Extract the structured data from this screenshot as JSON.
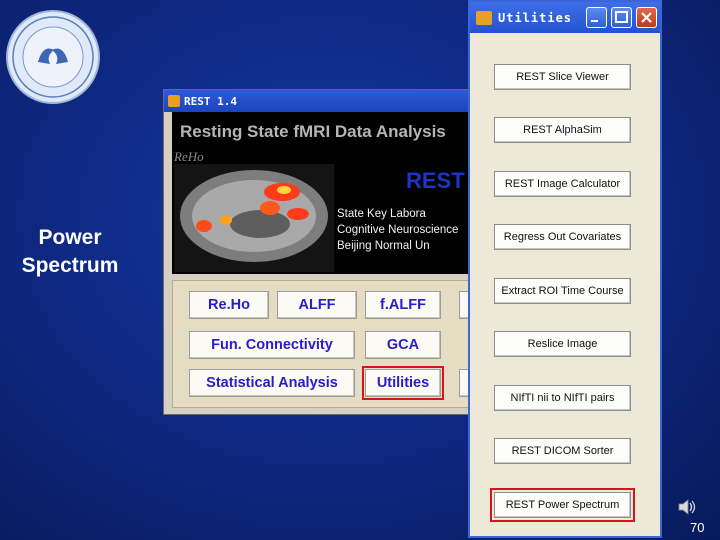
{
  "slide": {
    "label_line1": "Power",
    "label_line2": "Spectrum",
    "page_number": "70"
  },
  "rest_window": {
    "title": "REST 1.4",
    "header_title": "Resting State fMRI Data Analysis",
    "reho_watermark": "ReHo",
    "brand": "REST",
    "lab_lines": [
      "State Key Labora",
      "Cognitive Neuroscience",
      "Beijing Normal Un"
    ],
    "buttons": {
      "reho": "Re.Ho",
      "alff": "ALFF",
      "falff": "f.ALFF",
      "fun_connectivity": "Fun. Connectivity",
      "gca": "GCA",
      "statistical_analysis": "Statistical Analysis",
      "utilities": "Utilities"
    },
    "selected_button": "utilities"
  },
  "utilities_window": {
    "title": "Utilities",
    "buttons": [
      "REST Slice Viewer",
      "REST AlphaSim",
      "REST Image Calculator",
      "Regress Out Covariates",
      "Extract ROI Time Course",
      "Reslice Image",
      "NIfTI nii to NIfTI pairs",
      "REST DICOM Sorter",
      "REST Power Spectrum"
    ],
    "selected_button": "REST Power Spectrum"
  },
  "colors": {
    "background": "#0f2a86",
    "rest_button_text": "#2a1cc9",
    "highlight": "#d4151b",
    "titlebar": "#2353cf"
  }
}
